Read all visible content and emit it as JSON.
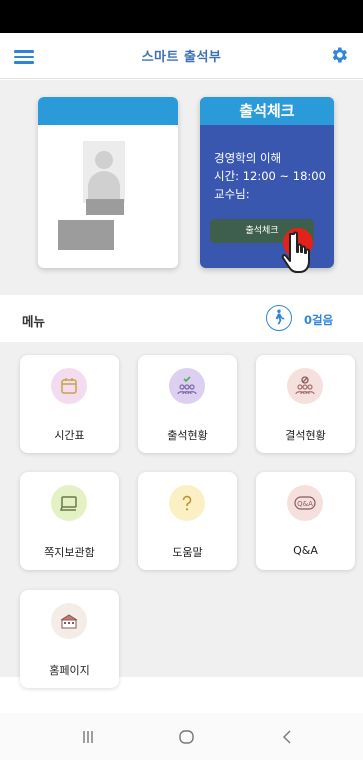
{
  "header": {
    "title": "스마트 출석부",
    "menu_icon": "hamburger-icon",
    "settings_icon": "gear-icon"
  },
  "check_card": {
    "title": "출석체크",
    "course": "경영학의 이해",
    "time": "시간: 12:00 ~ 18:00",
    "professor": "교수님:",
    "button_label": "출석체크"
  },
  "menu": {
    "label": "메뉴",
    "steps": "0걸음",
    "walk_icon": "walking-person-icon"
  },
  "tiles": [
    {
      "label": "시간표",
      "icon": "calendar-icon",
      "color": "#f4dcf0"
    },
    {
      "label": "출석현황",
      "icon": "attendance-group-check-icon",
      "color": "#dccff0"
    },
    {
      "label": "결석현황",
      "icon": "absence-group-icon",
      "color": "#f6e0de"
    },
    {
      "label": "쪽지보관함",
      "icon": "message-icon",
      "color": "#e3f1c5"
    },
    {
      "label": "도움말",
      "icon": "question-icon",
      "color": "#fbefc4"
    },
    {
      "label": "Q&A",
      "icon": "qa-icon",
      "color": "#f6e0de"
    },
    {
      "label": "홈페이지",
      "icon": "school-building-icon",
      "color": "#f4ece6"
    }
  ],
  "nav": {
    "recent_icon": "recent-apps-icon",
    "home_icon": "home-icon",
    "back_icon": "back-icon"
  },
  "colors": {
    "accent": "#2b9ad9",
    "card_blue": "#3a57b0",
    "button_green": "#3e5f4c",
    "tap_red": "#e2231a"
  }
}
